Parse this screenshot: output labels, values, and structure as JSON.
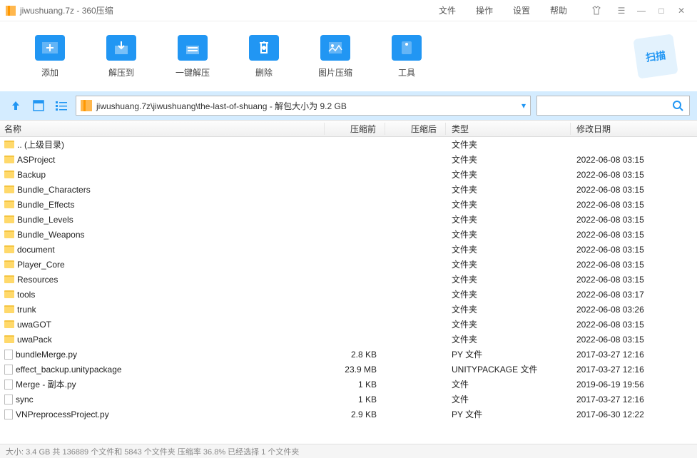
{
  "titlebar": {
    "title": "jiwushuang.7z - 360压缩",
    "menus": {
      "file": "文件",
      "operate": "操作",
      "settings": "设置",
      "help": "帮助"
    }
  },
  "toolbar": {
    "add": "添加",
    "extract_to": "解压到",
    "one_click": "一键解压",
    "delete": "删除",
    "img_compress": "图片压缩",
    "tools": "工具",
    "scan": "扫描"
  },
  "nav": {
    "path": "jiwushuang.7z\\jiwushuang\\the-last-of-shuang - 解包大小为 9.2 GB"
  },
  "columns": {
    "name": "名称",
    "before": "压缩前",
    "after": "压缩后",
    "type": "类型",
    "date": "修改日期"
  },
  "rows": [
    {
      "icon": "folder",
      "name": ".. (上级目录)",
      "before": "",
      "after": "",
      "type": "文件夹",
      "date": ""
    },
    {
      "icon": "folder",
      "name": "ASProject",
      "before": "",
      "after": "",
      "type": "文件夹",
      "date": "2022-06-08 03:15"
    },
    {
      "icon": "folder",
      "name": "Backup",
      "before": "",
      "after": "",
      "type": "文件夹",
      "date": "2022-06-08 03:15"
    },
    {
      "icon": "folder",
      "name": "Bundle_Characters",
      "before": "",
      "after": "",
      "type": "文件夹",
      "date": "2022-06-08 03:15"
    },
    {
      "icon": "folder",
      "name": "Bundle_Effects",
      "before": "",
      "after": "",
      "type": "文件夹",
      "date": "2022-06-08 03:15"
    },
    {
      "icon": "folder",
      "name": "Bundle_Levels",
      "before": "",
      "after": "",
      "type": "文件夹",
      "date": "2022-06-08 03:15"
    },
    {
      "icon": "folder",
      "name": "Bundle_Weapons",
      "before": "",
      "after": "",
      "type": "文件夹",
      "date": "2022-06-08 03:15"
    },
    {
      "icon": "folder",
      "name": "document",
      "before": "",
      "after": "",
      "type": "文件夹",
      "date": "2022-06-08 03:15"
    },
    {
      "icon": "folder",
      "name": "Player_Core",
      "before": "",
      "after": "",
      "type": "文件夹",
      "date": "2022-06-08 03:15"
    },
    {
      "icon": "folder",
      "name": "Resources",
      "before": "",
      "after": "",
      "type": "文件夹",
      "date": "2022-06-08 03:15"
    },
    {
      "icon": "folder",
      "name": "tools",
      "before": "",
      "after": "",
      "type": "文件夹",
      "date": "2022-06-08 03:17"
    },
    {
      "icon": "folder",
      "name": "trunk",
      "before": "",
      "after": "",
      "type": "文件夹",
      "date": "2022-06-08 03:26"
    },
    {
      "icon": "folder",
      "name": "uwaGOT",
      "before": "",
      "after": "",
      "type": "文件夹",
      "date": "2022-06-08 03:15"
    },
    {
      "icon": "folder",
      "name": "uwaPack",
      "before": "",
      "after": "",
      "type": "文件夹",
      "date": "2022-06-08 03:15"
    },
    {
      "icon": "file",
      "name": "bundleMerge.py",
      "before": "2.8 KB",
      "after": "",
      "type": "PY 文件",
      "date": "2017-03-27 12:16"
    },
    {
      "icon": "file",
      "name": "effect_backup.unitypackage",
      "before": "23.9 MB",
      "after": "",
      "type": "UNITYPACKAGE 文件",
      "date": "2017-03-27 12:16"
    },
    {
      "icon": "file",
      "name": "Merge - 副本.py",
      "before": "1 KB",
      "after": "",
      "type": "文件",
      "date": "2019-06-19 19:56"
    },
    {
      "icon": "file",
      "name": "sync",
      "before": "1 KB",
      "after": "",
      "type": "文件",
      "date": "2017-03-27 12:16"
    },
    {
      "icon": "file",
      "name": "VNPreprocessProject.py",
      "before": "2.9 KB",
      "after": "",
      "type": "PY 文件",
      "date": "2017-06-30 12:22"
    }
  ],
  "statusbar": "大小: 3.4 GB 共 136889 个文件和 5843 个文件夹 压缩率 36.8%  已经选择 1 个文件夹"
}
